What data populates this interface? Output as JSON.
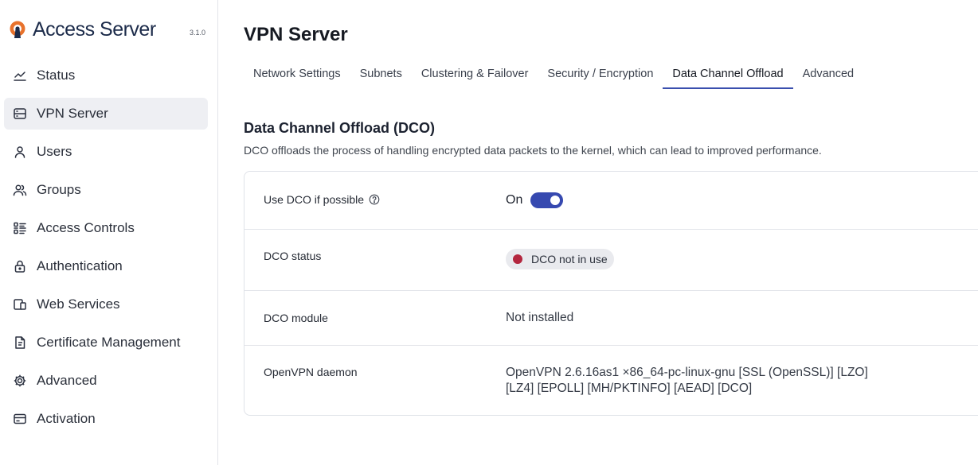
{
  "brand": {
    "name": "Access Server",
    "version": "3.1.0"
  },
  "sidebar": {
    "items": [
      {
        "label": "Status",
        "icon": "chart-line-icon"
      },
      {
        "label": "VPN Server",
        "icon": "server-icon",
        "active": true
      },
      {
        "label": "Users",
        "icon": "user-icon"
      },
      {
        "label": "Groups",
        "icon": "users-icon"
      },
      {
        "label": "Access Controls",
        "icon": "list-checks-icon"
      },
      {
        "label": "Authentication",
        "icon": "lock-icon"
      },
      {
        "label": "Web Services",
        "icon": "devices-icon"
      },
      {
        "label": "Certificate Management",
        "icon": "certificate-icon"
      },
      {
        "label": "Advanced",
        "icon": "gear-icon"
      },
      {
        "label": "Activation",
        "icon": "card-icon"
      }
    ]
  },
  "main": {
    "title": "VPN Server",
    "tabs": [
      {
        "label": "Network Settings"
      },
      {
        "label": "Subnets"
      },
      {
        "label": "Clustering & Failover"
      },
      {
        "label": "Security / Encryption"
      },
      {
        "label": "Data Channel Offload",
        "active": true
      },
      {
        "label": "Advanced"
      }
    ],
    "section": {
      "title": "Data Channel Offload (DCO)",
      "description": "DCO offloads the process of handling encrypted data packets to the kernel, which can lead to improved performance."
    },
    "settings": {
      "use_dco": {
        "label": "Use DCO if possible",
        "value": "On",
        "enabled": true
      },
      "dco_status": {
        "label": "DCO status",
        "value": "DCO not in use",
        "status_color": "#b3263e"
      },
      "dco_module": {
        "label": "DCO module",
        "value": "Not installed"
      },
      "daemon": {
        "label": "OpenVPN daemon",
        "value_line1": "OpenVPN 2.6.16as1 ×86_64-pc-linux-gnu [SSL (OpenSSL)] [LZO]",
        "value_line2": "[LZ4] [EPOLL] [MH/PKTINFO] [AEAD] [DCO]"
      }
    }
  },
  "colors": {
    "accent": "#3649b0",
    "brand": "#1c2b4a",
    "logo_orange": "#e8722c"
  }
}
